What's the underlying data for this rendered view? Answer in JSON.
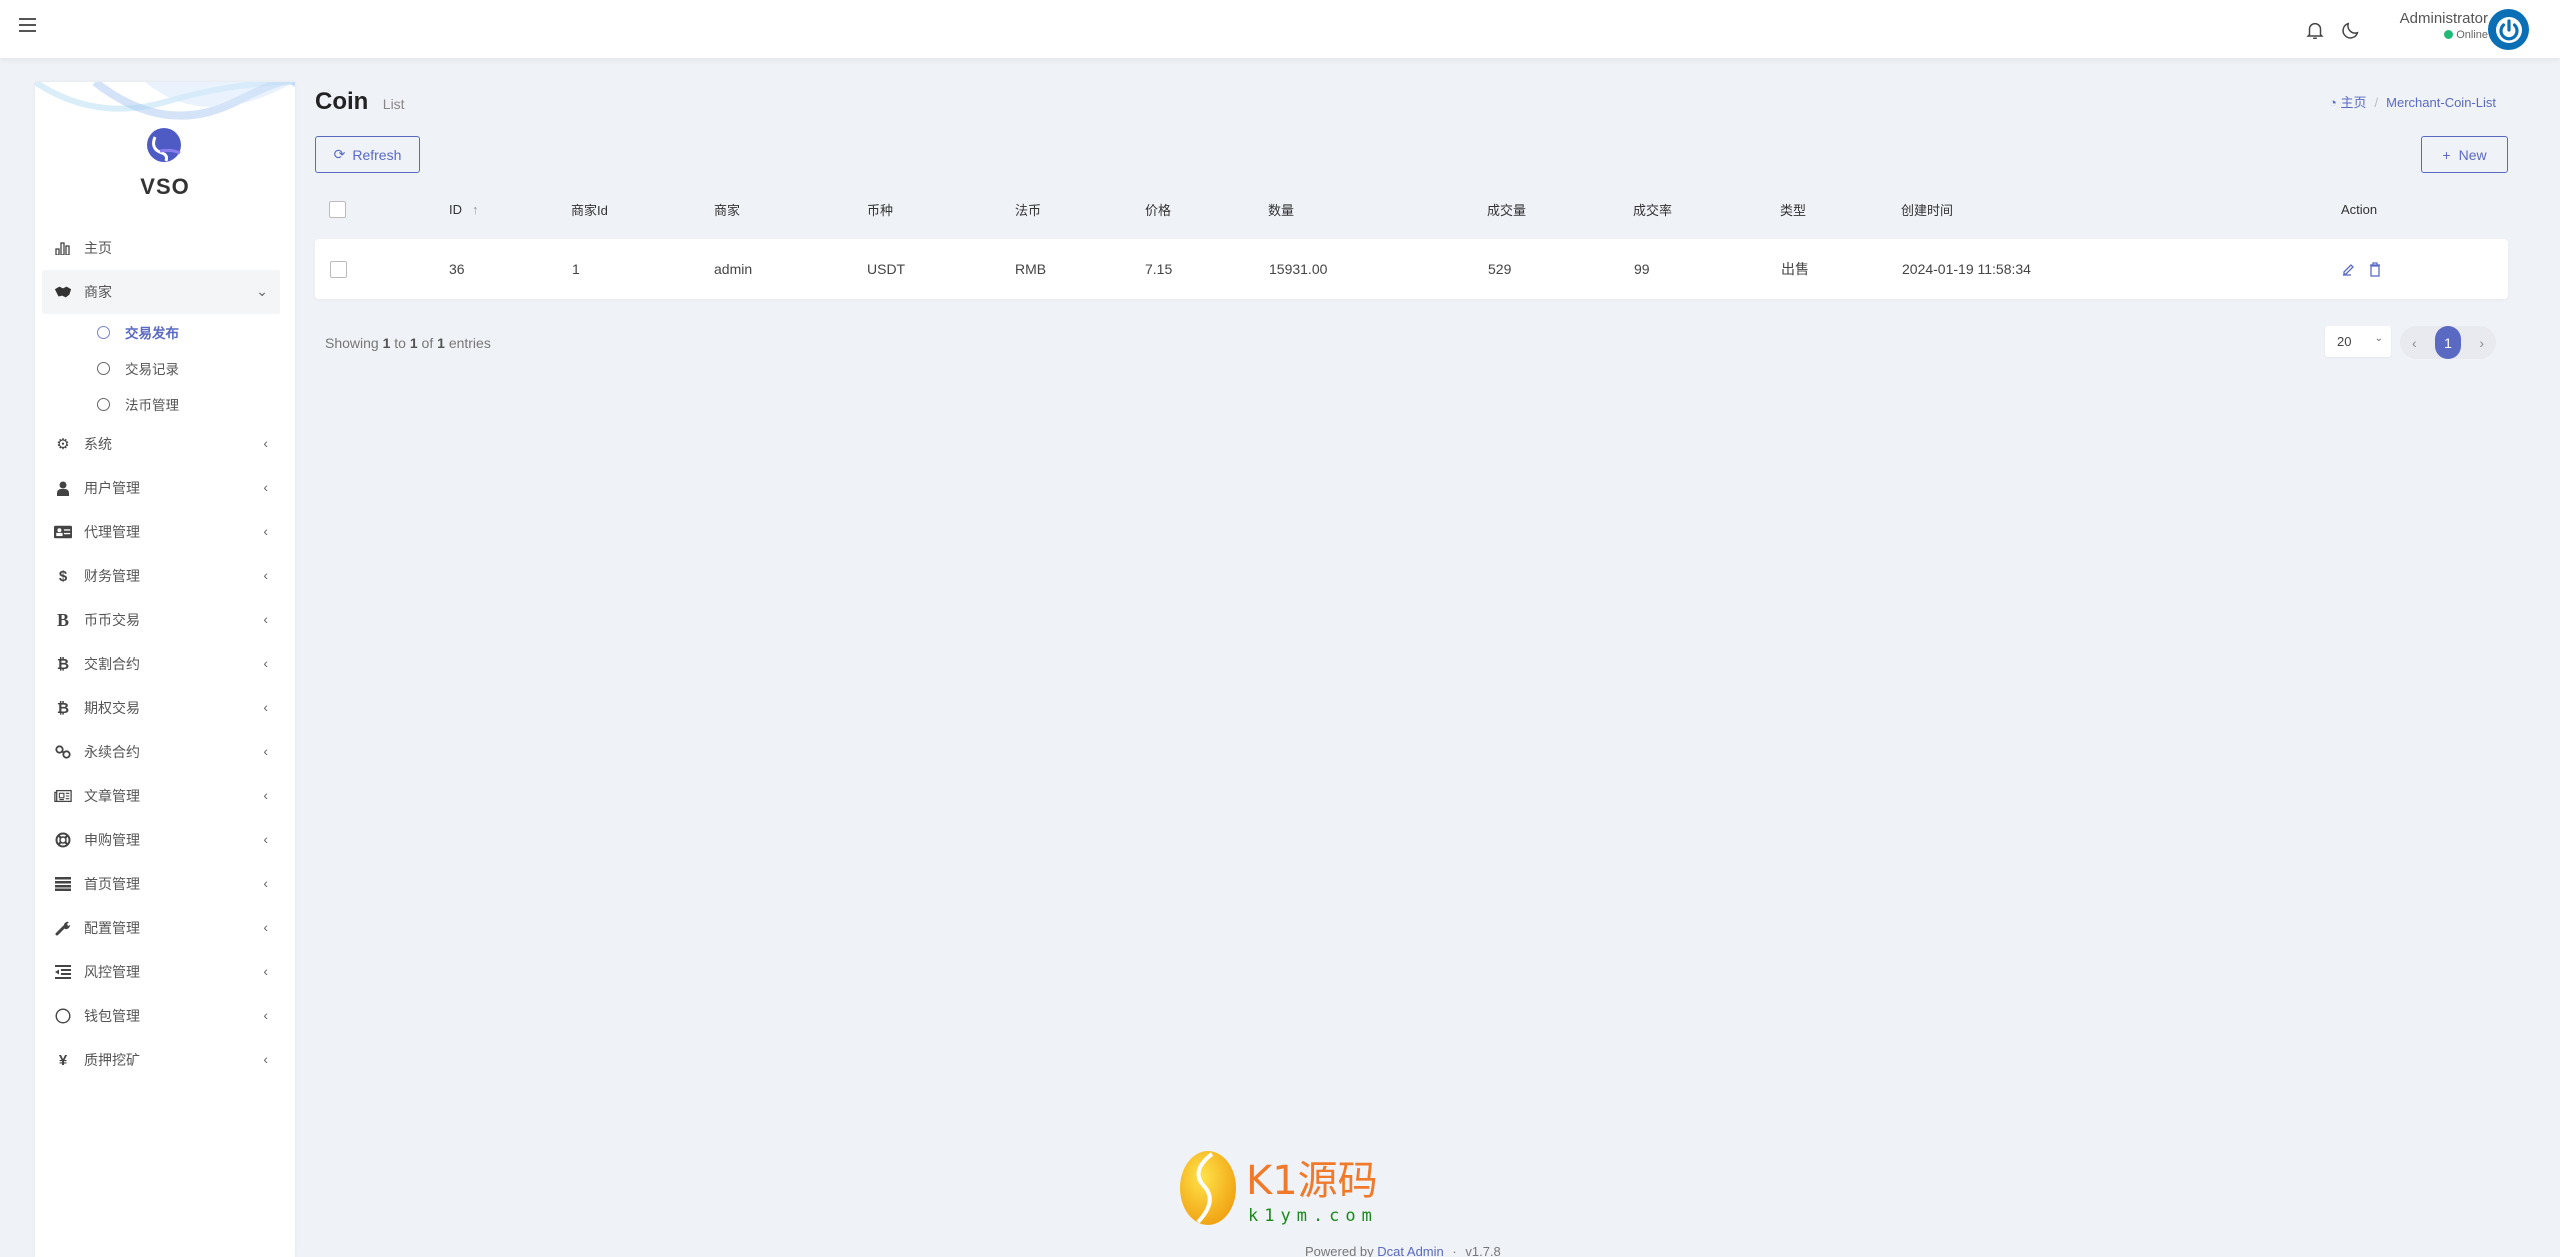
{
  "navbar": {
    "user_name": "Administrator",
    "user_status": "Online"
  },
  "sidebar": {
    "brand": "VSO",
    "items": [
      {
        "label": "主页",
        "icon": "bar-chart-icon"
      },
      {
        "label": "商家",
        "icon": "handshake-icon",
        "open": true,
        "children": [
          {
            "label": "交易发布",
            "active": true
          },
          {
            "label": "交易记录"
          },
          {
            "label": "法币管理"
          }
        ]
      },
      {
        "label": "系统",
        "icon": "gear-icon"
      },
      {
        "label": "用户管理",
        "icon": "user-doctor-icon"
      },
      {
        "label": "代理管理",
        "icon": "id-card-icon"
      },
      {
        "label": "财务管理",
        "icon": "dollar-icon"
      },
      {
        "label": "币币交易",
        "icon": "b-letter-icon"
      },
      {
        "label": "交割合约",
        "icon": "bitcoin-icon"
      },
      {
        "label": "期权交易",
        "icon": "bitcoin-icon"
      },
      {
        "label": "永续合约",
        "icon": "link-icon"
      },
      {
        "label": "文章管理",
        "icon": "newspaper-icon"
      },
      {
        "label": "申购管理",
        "icon": "life-ring-icon"
      },
      {
        "label": "首页管理",
        "icon": "bars-icon"
      },
      {
        "label": "配置管理",
        "icon": "wrench-icon"
      },
      {
        "label": "风控管理",
        "icon": "indent-icon"
      },
      {
        "label": "钱包管理",
        "icon": "circle-icon"
      },
      {
        "label": "质押挖矿",
        "icon": "yen-icon"
      }
    ]
  },
  "header": {
    "title": "Coin",
    "subtitle": "List",
    "breadcrumb": [
      {
        "label": "主页",
        "icon": "dashboard-icon"
      },
      {
        "label": "Merchant-Coin-List"
      }
    ]
  },
  "toolbar": {
    "refresh_label": "Refresh",
    "new_label": "New"
  },
  "table": {
    "columns": [
      "ID",
      "商家Id",
      "商家",
      "币种",
      "法币",
      "价格",
      "数量",
      "成交量",
      "成交率",
      "类型",
      "创建时间",
      "Action"
    ],
    "rows": [
      {
        "id": "36",
        "merchant_id": "1",
        "merchant": "admin",
        "coin": "USDT",
        "fiat": "RMB",
        "price": "7.15",
        "quantity": "15931.00",
        "volume": "529",
        "rate": "99",
        "type": "出售",
        "created_at": "2024-01-19 11:58:34"
      }
    ]
  },
  "pagination": {
    "showing_prefix": "Showing",
    "from": "1",
    "to_word": "to",
    "to": "1",
    "of_word": "of",
    "total": "1",
    "entries_word": "entries",
    "per_page": "20",
    "current_page": "1"
  },
  "footer": {
    "logo_text": "K1源码",
    "logo_domain": "k1ym.com",
    "powered_by": "Powered by",
    "link_text": "Dcat Admin",
    "separator": "·",
    "version": "v1.7.8"
  },
  "colors": {
    "accent": "#5a6ac2",
    "background": "#eff2f7",
    "online": "#21b978"
  }
}
